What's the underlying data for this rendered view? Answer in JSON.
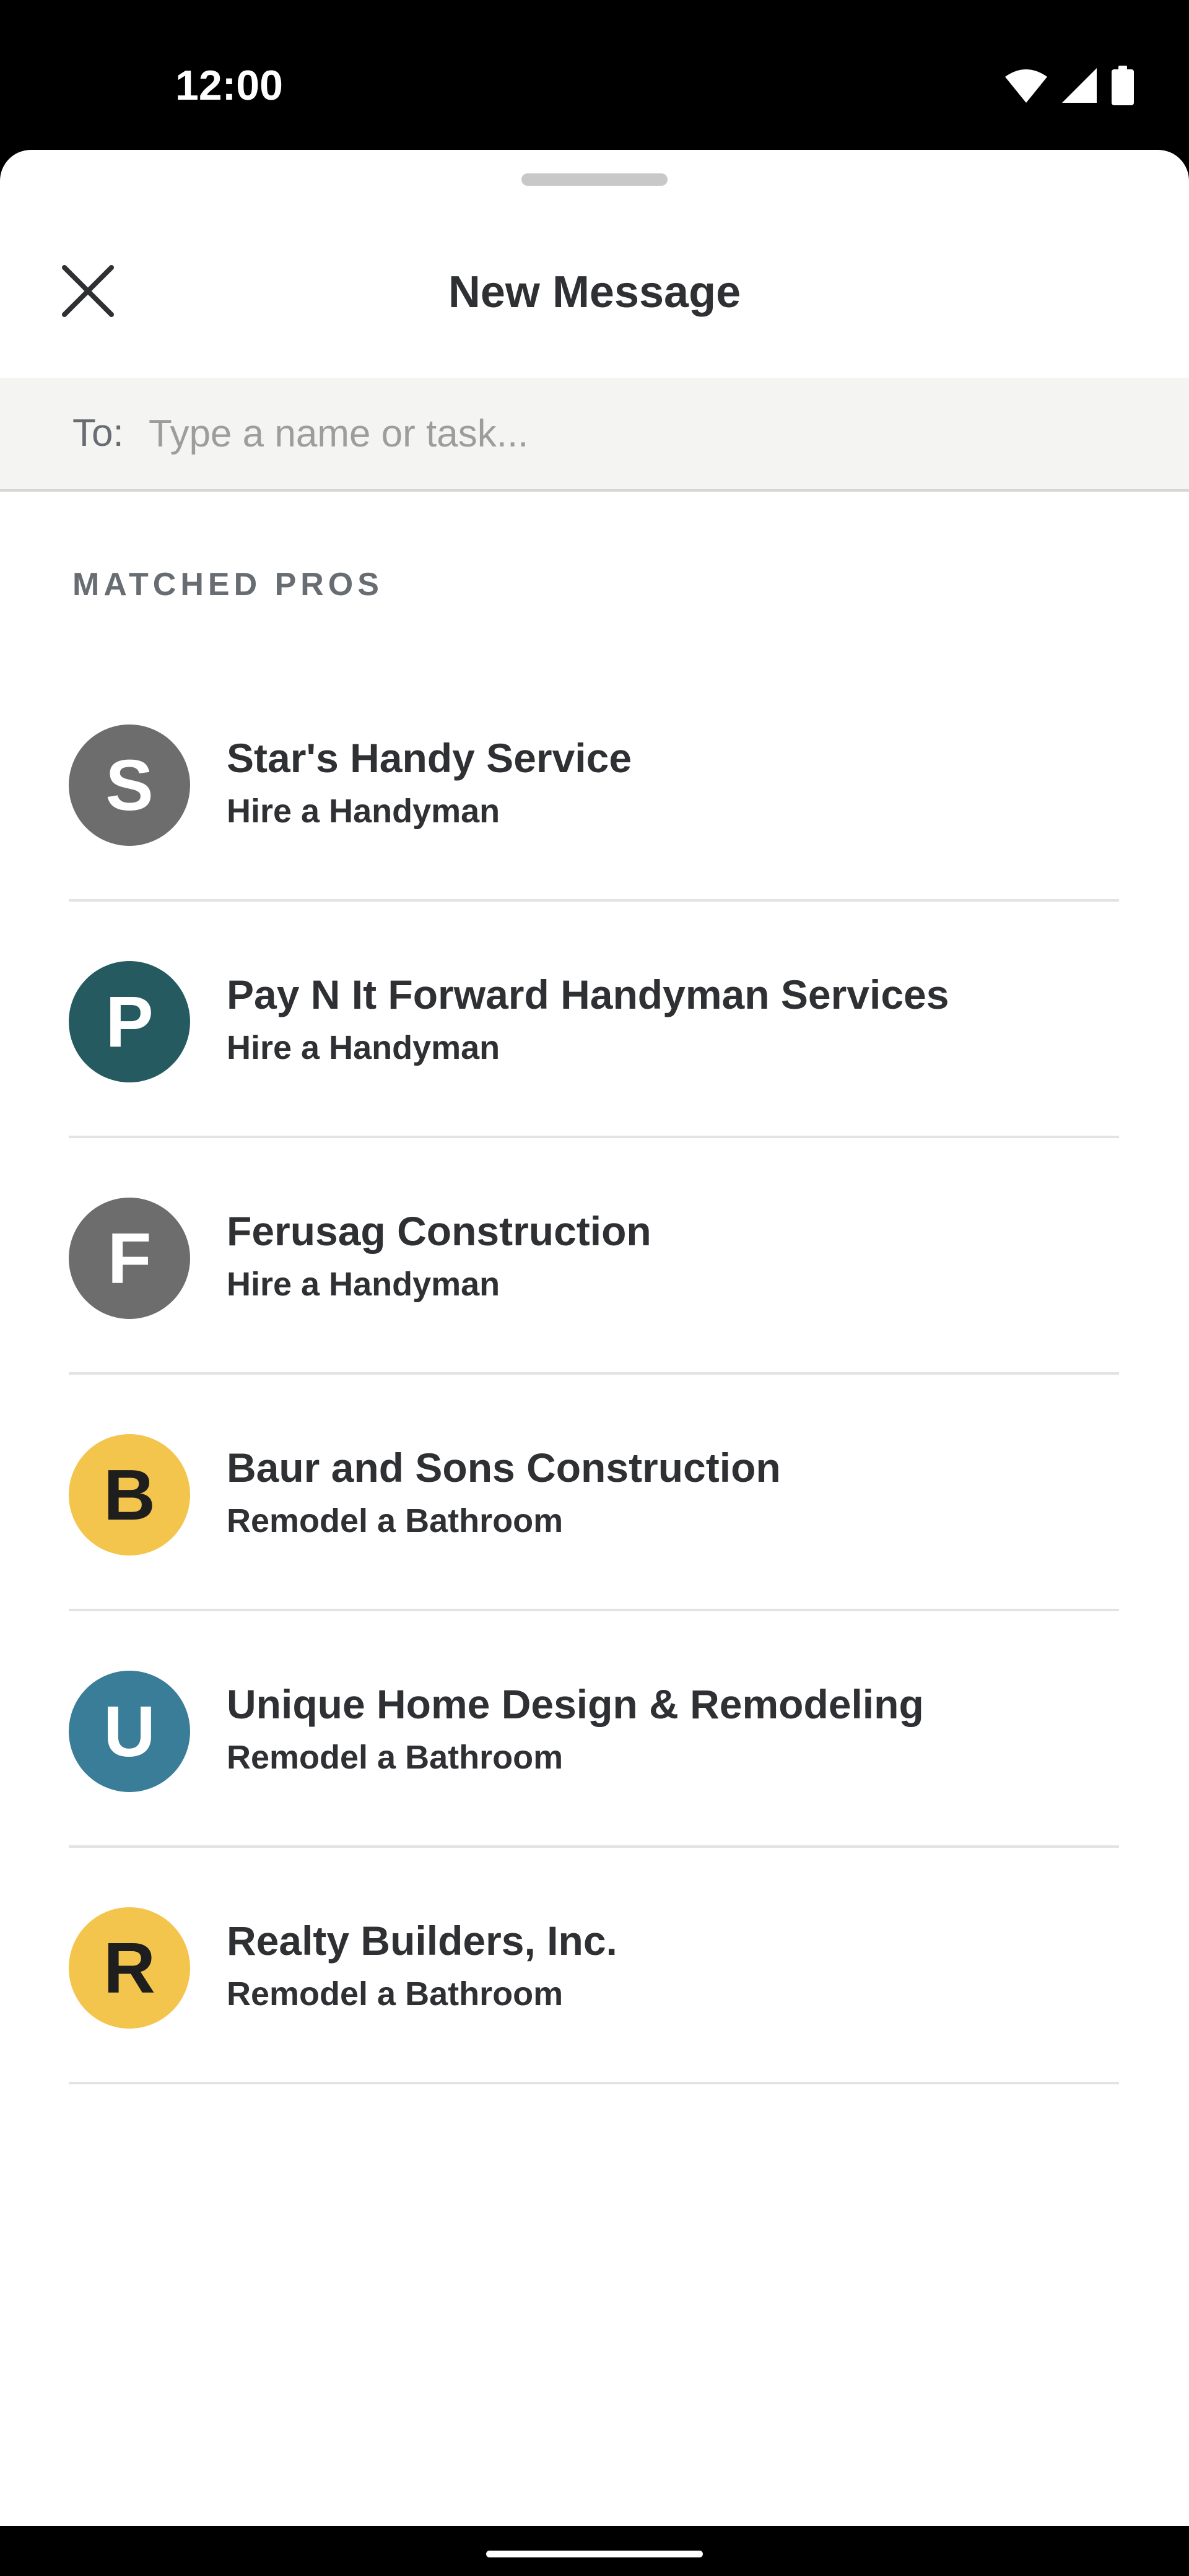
{
  "status_bar": {
    "time": "12:00",
    "icons": [
      "wifi-icon",
      "cellular-signal-icon",
      "battery-icon"
    ]
  },
  "header": {
    "title": "New Message",
    "close_icon": "close-icon"
  },
  "recipient": {
    "label": "To:",
    "placeholder": "Type a name or task..."
  },
  "matched_pros": {
    "heading": "MATCHED PROS",
    "items": [
      {
        "initial": "S",
        "name": "Star's Handy Service",
        "task": "Hire a Handyman",
        "avatar_color": "#6d6d6d",
        "initial_color": "#ffffff"
      },
      {
        "initial": "P",
        "name": "Pay N It Forward Handyman Services",
        "task": "Hire a Handyman",
        "avatar_color": "#265a61",
        "initial_color": "#ffffff"
      },
      {
        "initial": "F",
        "name": "Ferusag Construction",
        "task": "Hire a Handyman",
        "avatar_color": "#6d6d6d",
        "initial_color": "#ffffff"
      },
      {
        "initial": "B",
        "name": "Baur and Sons Construction",
        "task": "Remodel a Bathroom",
        "avatar_color": "#f4c54c",
        "initial_color": "#1e1e1e"
      },
      {
        "initial": "U",
        "name": "Unique Home Design & Remodeling",
        "task": "Remodel a Bathroom",
        "avatar_color": "#3a7d98",
        "initial_color": "#ffffff"
      },
      {
        "initial": "R",
        "name": "Realty Builders, Inc.",
        "task": "Remodel a Bathroom",
        "avatar_color": "#f4c54c",
        "initial_color": "#1e1e1e"
      }
    ]
  }
}
